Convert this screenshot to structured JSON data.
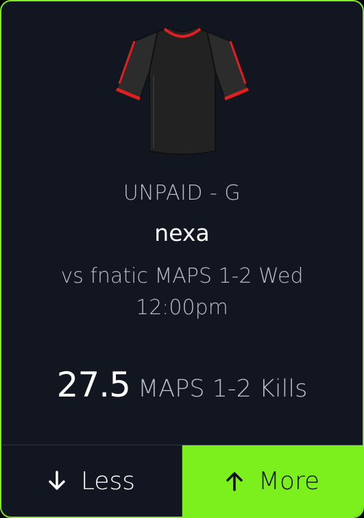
{
  "card": {
    "jersey_icon": "jersey-icon",
    "team_position": "UNPAID - G",
    "player_name": "nexa",
    "match_info": "vs fnatic MAPS 1-2 Wed 12:00pm",
    "projection": {
      "line_value": "27.5",
      "stat_type": "MAPS 1-2 Kills"
    },
    "actions": {
      "less_label": "Less",
      "less_icon": "arrow-down-icon",
      "more_label": "More",
      "more_icon": "arrow-up-icon"
    }
  },
  "colors": {
    "accent": "#7cf01c",
    "card_background": "#121620",
    "jersey_body": "#222222",
    "jersey_trim": "#e02020"
  }
}
